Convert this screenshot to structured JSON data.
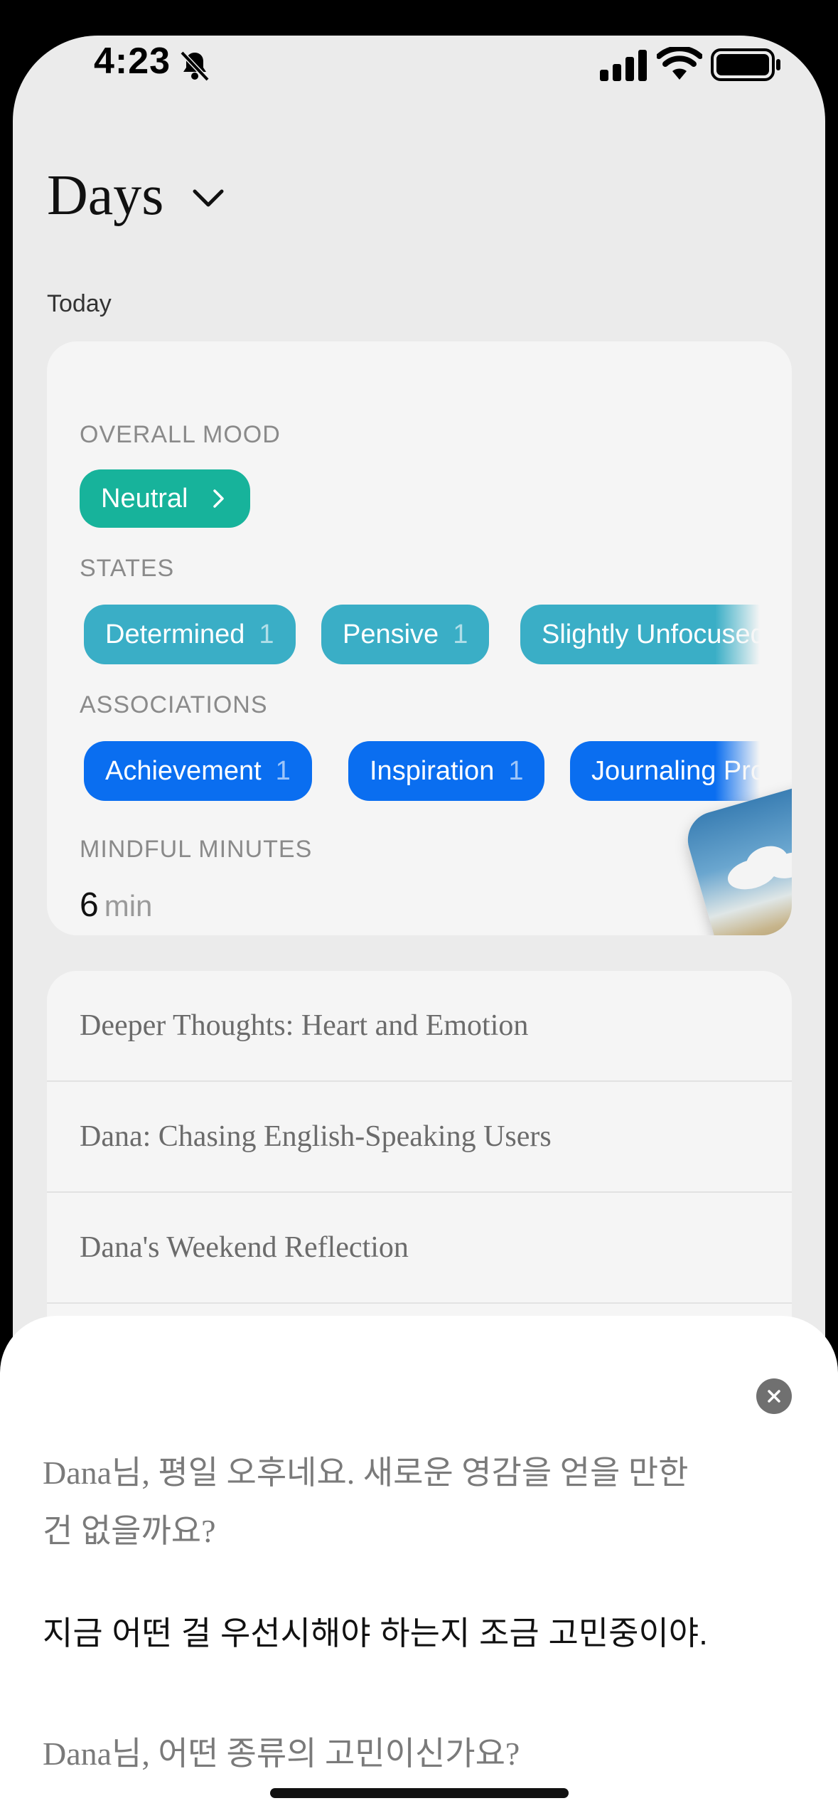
{
  "status_bar": {
    "time": "4:23",
    "icons": [
      "bell-slash-icon",
      "cellular-signal-icon",
      "wifi-icon",
      "battery-icon"
    ]
  },
  "header": {
    "title": "Days",
    "dropdown_icon": "chevron-down-icon"
  },
  "section": {
    "label": "Today"
  },
  "summary_card": {
    "overall_mood_label": "OVERALL MOOD",
    "mood": "Neutral",
    "states_label": "STATES",
    "states": [
      {
        "label": "Determined",
        "count": "1"
      },
      {
        "label": "Pensive",
        "count": "1"
      },
      {
        "label": "Slightly Unfocused",
        "count": ""
      }
    ],
    "associations_label": "ASSOCIATIONS",
    "associations": [
      {
        "label": "Achievement",
        "count": "1"
      },
      {
        "label": "Inspiration",
        "count": "1"
      },
      {
        "label": "Journaling Pro",
        "count": ""
      }
    ],
    "mindful_label": "MINDFUL MINUTES",
    "mindful_value": "6",
    "mindful_unit": "min"
  },
  "entries": [
    "Deeper Thoughts: Heart and Emotion",
    "Dana: Chasing English-Speaking Users",
    "Dana's Weekend Reflection"
  ],
  "chat_sheet": {
    "messages": [
      {
        "role": "assistant",
        "text_line1": "Dana님, 평일 오후네요. 새로운 영감을 얻을 만한",
        "text_line2": "건 없을까요?"
      },
      {
        "role": "user",
        "text": "지금 어떤 걸 우선시해야 하는지 조금 고민중이야."
      },
      {
        "role": "assistant",
        "text": "Dana님, 어떤 종류의 고민이신가요?"
      }
    ]
  },
  "colors": {
    "mood_neutral": "#17b39b",
    "state_pill": "#3aaec6",
    "association_pill": "#0a6ef0",
    "background": "#ebebeb",
    "card": "#f5f5f5"
  }
}
